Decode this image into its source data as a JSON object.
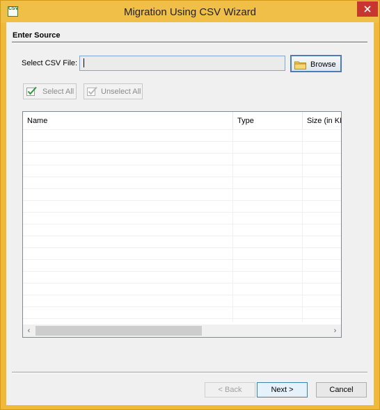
{
  "window": {
    "title": "Migration Using CSV Wizard",
    "icon": "csv-file-icon",
    "icon_text": "CSV"
  },
  "section": {
    "title": "Enter Source"
  },
  "csv_file": {
    "label": "Select CSV File:",
    "value": "",
    "placeholder": ""
  },
  "buttons": {
    "browse": "Browse",
    "select_all": "Select All",
    "unselect_all": "Unselect All",
    "back": "< Back",
    "next": "Next >",
    "cancel": "Cancel"
  },
  "grid": {
    "columns": [
      "Name",
      "Type",
      "Size (in KB"
    ],
    "rows": []
  },
  "colors": {
    "title_bar": "#f0bf48",
    "close_button": "#c7372f",
    "focus_border": "#4a7eb8"
  }
}
